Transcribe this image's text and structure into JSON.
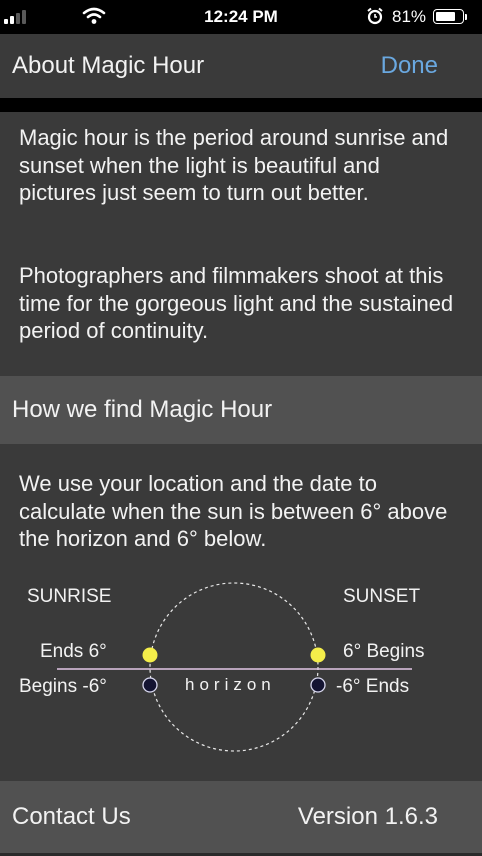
{
  "status_bar": {
    "time": "12:24 PM",
    "battery_percent": "81%",
    "battery_level": 0.81,
    "icons": [
      "signal-icon",
      "wifi-icon",
      "alarm-icon",
      "battery-icon"
    ]
  },
  "navbar": {
    "title": "About Magic Hour",
    "done_label": "Done",
    "done_color": "#6aa8e0"
  },
  "about": {
    "paragraph1": "Magic hour is the period around sunrise and sunset when the light is beautiful and pictures just seem to turn out better.",
    "paragraph2": "Photographers and filmmakers shoot at this time for the gorgeous light and the sustained period of continuity."
  },
  "how_section": {
    "header": "How we find Magic Hour",
    "description": "We use your location and the date to calculate when the sun is between 6° above the horizon and 6° below."
  },
  "diagram": {
    "sunrise_label": "SUNRISE",
    "sunset_label": "SUNSET",
    "sunrise_ends": "Ends  6°",
    "sunrise_begins": "Begins -6°",
    "sunset_begins": "6° Begins",
    "sunset_ends": "-6° Ends",
    "horizon_label": "horizon",
    "sun_color": "#f4ee4a",
    "dark_sun_color": "#141432",
    "horizon_color": "#e2c6e6"
  },
  "footer": {
    "contact_label": "Contact Us",
    "version_label": "Version 1.6.3"
  }
}
